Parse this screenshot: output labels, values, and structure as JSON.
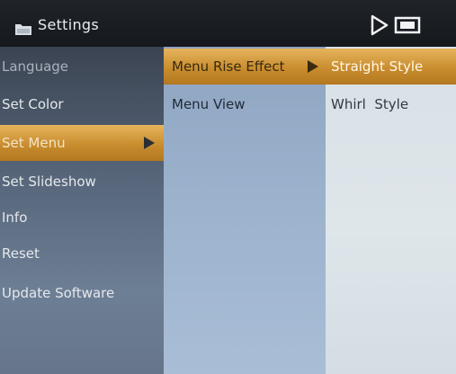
{
  "title_bar": {
    "title": "Settings",
    "title_icon": "folder-icon",
    "status_icons": [
      "play-icon",
      "battery-icon"
    ]
  },
  "menu_level1": {
    "items": [
      {
        "label": "Language"
      },
      {
        "label": "Set Color"
      },
      {
        "label": "Set Menu",
        "selected": true
      },
      {
        "label": "Set Slideshow"
      },
      {
        "label": "Info"
      },
      {
        "label": "Reset"
      },
      {
        "label": "Update Software"
      }
    ]
  },
  "menu_level2": {
    "items": [
      {
        "label": "Menu Rise Effect",
        "selected": true
      },
      {
        "label": "Menu View"
      }
    ]
  },
  "menu_level3": {
    "items": [
      {
        "label": "Straight Style",
        "selected": true
      },
      {
        "label": "Whirl  Style"
      }
    ]
  },
  "colors": {
    "selection": "#c98d2f",
    "title_bar": "#15181c"
  }
}
